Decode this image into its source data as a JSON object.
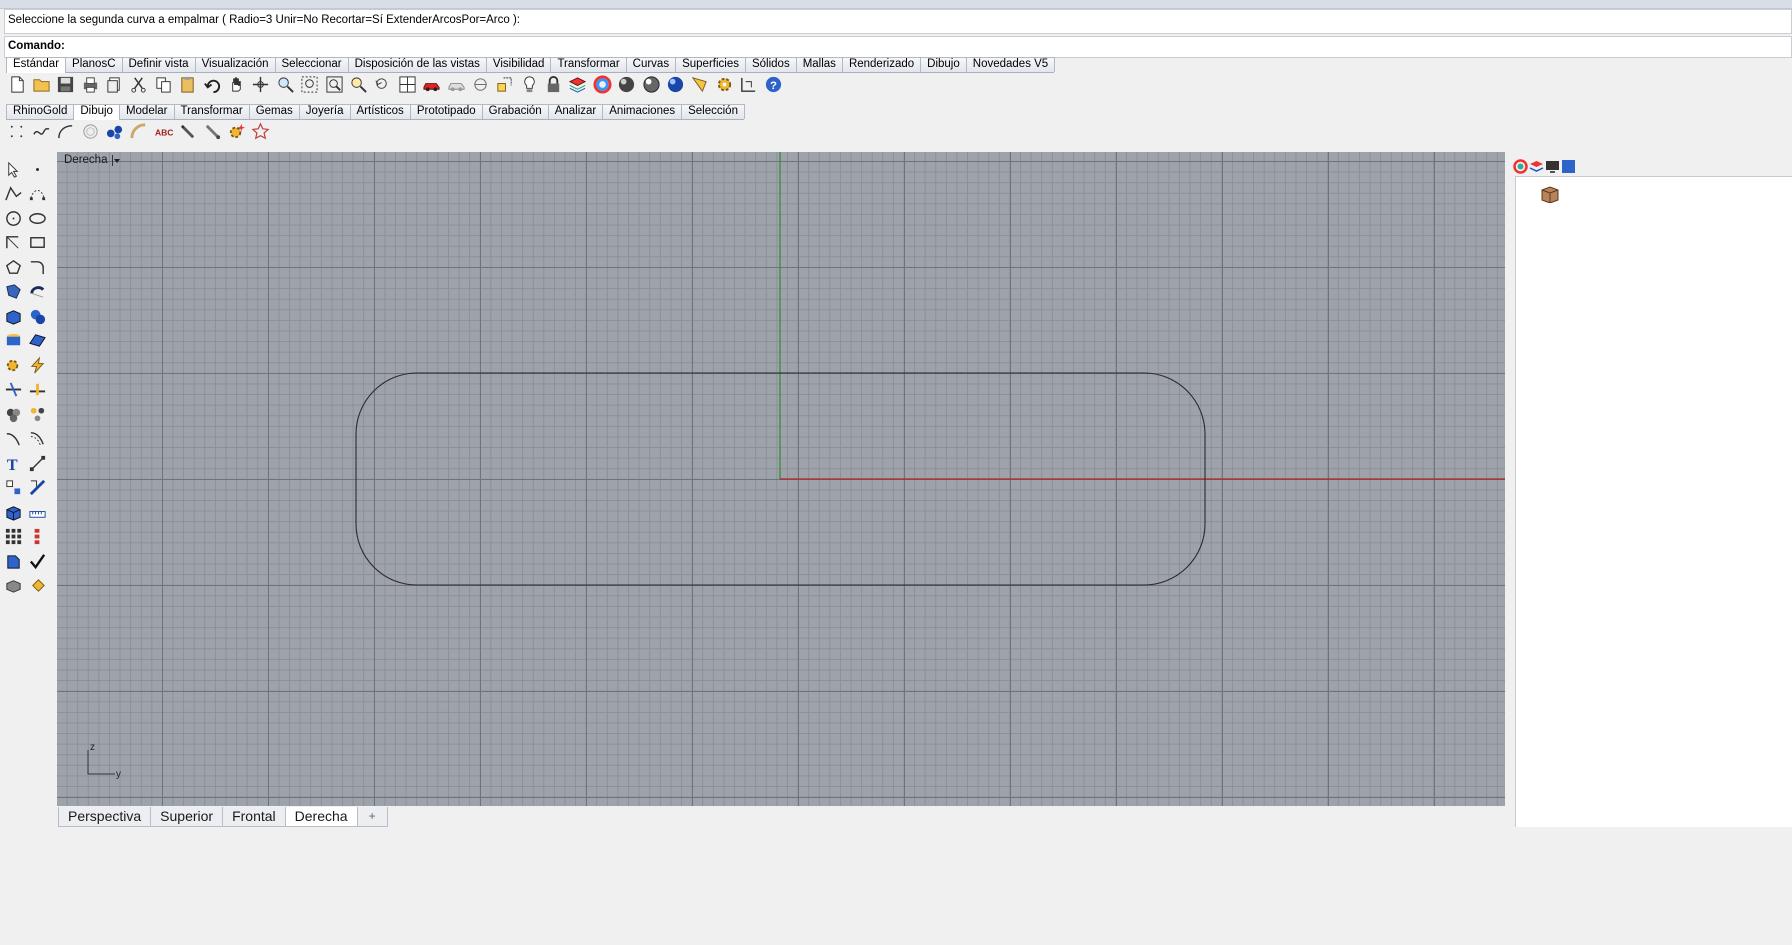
{
  "command_history": "Seleccione la segunda curva a empalmar ( Radio=3  Unir=No  Recortar=Sí  ExtenderArcosPor=Arco ):",
  "command_prompt": {
    "label": "Comando:",
    "value": ""
  },
  "tabs_row1": [
    "Estándar",
    "PlanosC",
    "Definir vista",
    "Visualización",
    "Seleccionar",
    "Disposición de las vistas",
    "Visibilidad",
    "Transformar",
    "Curvas",
    "Superficies",
    "Sólidos",
    "Mallas",
    "Renderizado",
    "Dibujo",
    "Novedades V5"
  ],
  "tabs_row1_active": "Estándar",
  "tabs_row2": [
    "RhinoGold",
    "Dibujo",
    "Modelar",
    "Transformar",
    "Gemas",
    "Joyería",
    "Artísticos",
    "Prototipado",
    "Grabación",
    "Analizar",
    "Animaciones",
    "Selección"
  ],
  "tabs_row2_active": "Dibujo",
  "viewport": {
    "title": "Derecha",
    "axis_z": "z",
    "axis_y": "y"
  },
  "viewport_tabs": [
    "Perspectiva",
    "Superior",
    "Frontal",
    "Derecha"
  ],
  "viewport_tabs_active": "Derecha",
  "colors": {
    "x_axis": "#b22222",
    "y_axis": "#2e8b2e",
    "curve": "#2a2a2a",
    "viewport_bg": "#9ea3ab"
  }
}
